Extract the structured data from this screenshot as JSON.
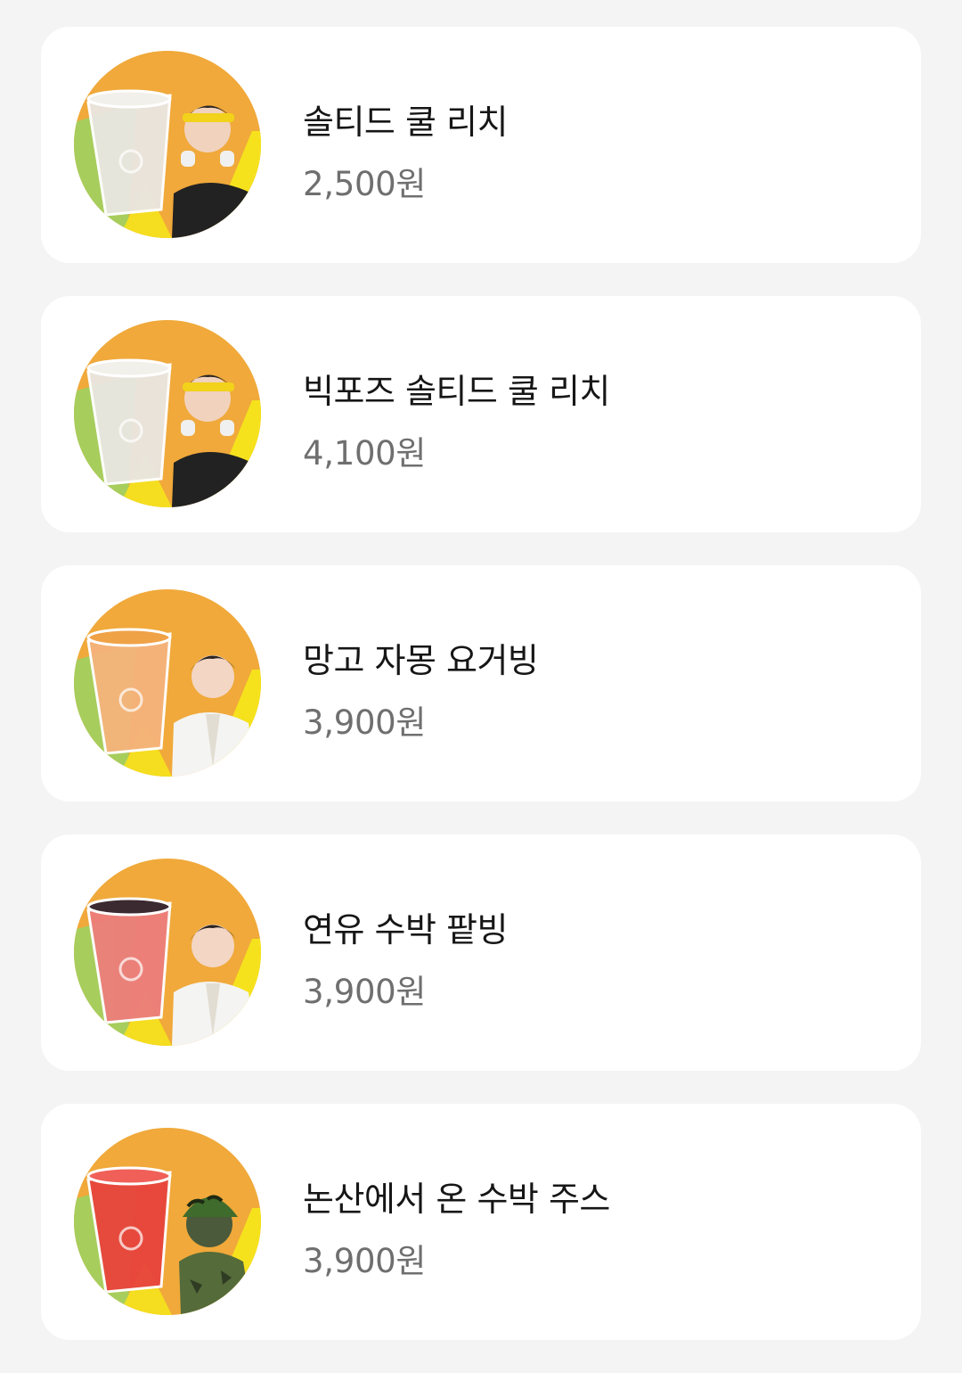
{
  "menu": {
    "items": [
      {
        "name": "솔티드 쿨 리치",
        "price": "2,500원",
        "drink_color": "#e9e6df",
        "drink_top": "#f2f0ea",
        "person": "headband-model",
        "icon": "drink-thumbnail"
      },
      {
        "name": "빅포즈 솔티드 쿨 리치",
        "price": "4,100원",
        "drink_color": "#e9e6df",
        "drink_top": "#f2f0ea",
        "person": "headband-model",
        "icon": "drink-thumbnail"
      },
      {
        "name": "망고 자몽 요거빙",
        "price": "3,900원",
        "drink_color": "#f4b37a",
        "drink_top": "#f0a247",
        "person": "lab-coat-model",
        "icon": "drink-thumbnail"
      },
      {
        "name": "연유 수박 팥빙",
        "price": "3,900원",
        "drink_color": "#ec7f7a",
        "drink_top": "#3b2a30",
        "person": "lab-coat-model",
        "icon": "drink-thumbnail"
      },
      {
        "name": "논산에서 온 수박 주스",
        "price": "3,900원",
        "drink_color": "#e8463c",
        "drink_top": "#f06058",
        "person": "soldier-model",
        "icon": "drink-thumbnail"
      }
    ]
  },
  "colors": {
    "background": "#f4f4f4",
    "card": "#ffffff",
    "name_text": "#161616",
    "price_text": "#6f6f6f",
    "thumb_orange": "#f0a93a",
    "thumb_green": "#a7cd5c",
    "thumb_yellow": "#f5e21d"
  }
}
